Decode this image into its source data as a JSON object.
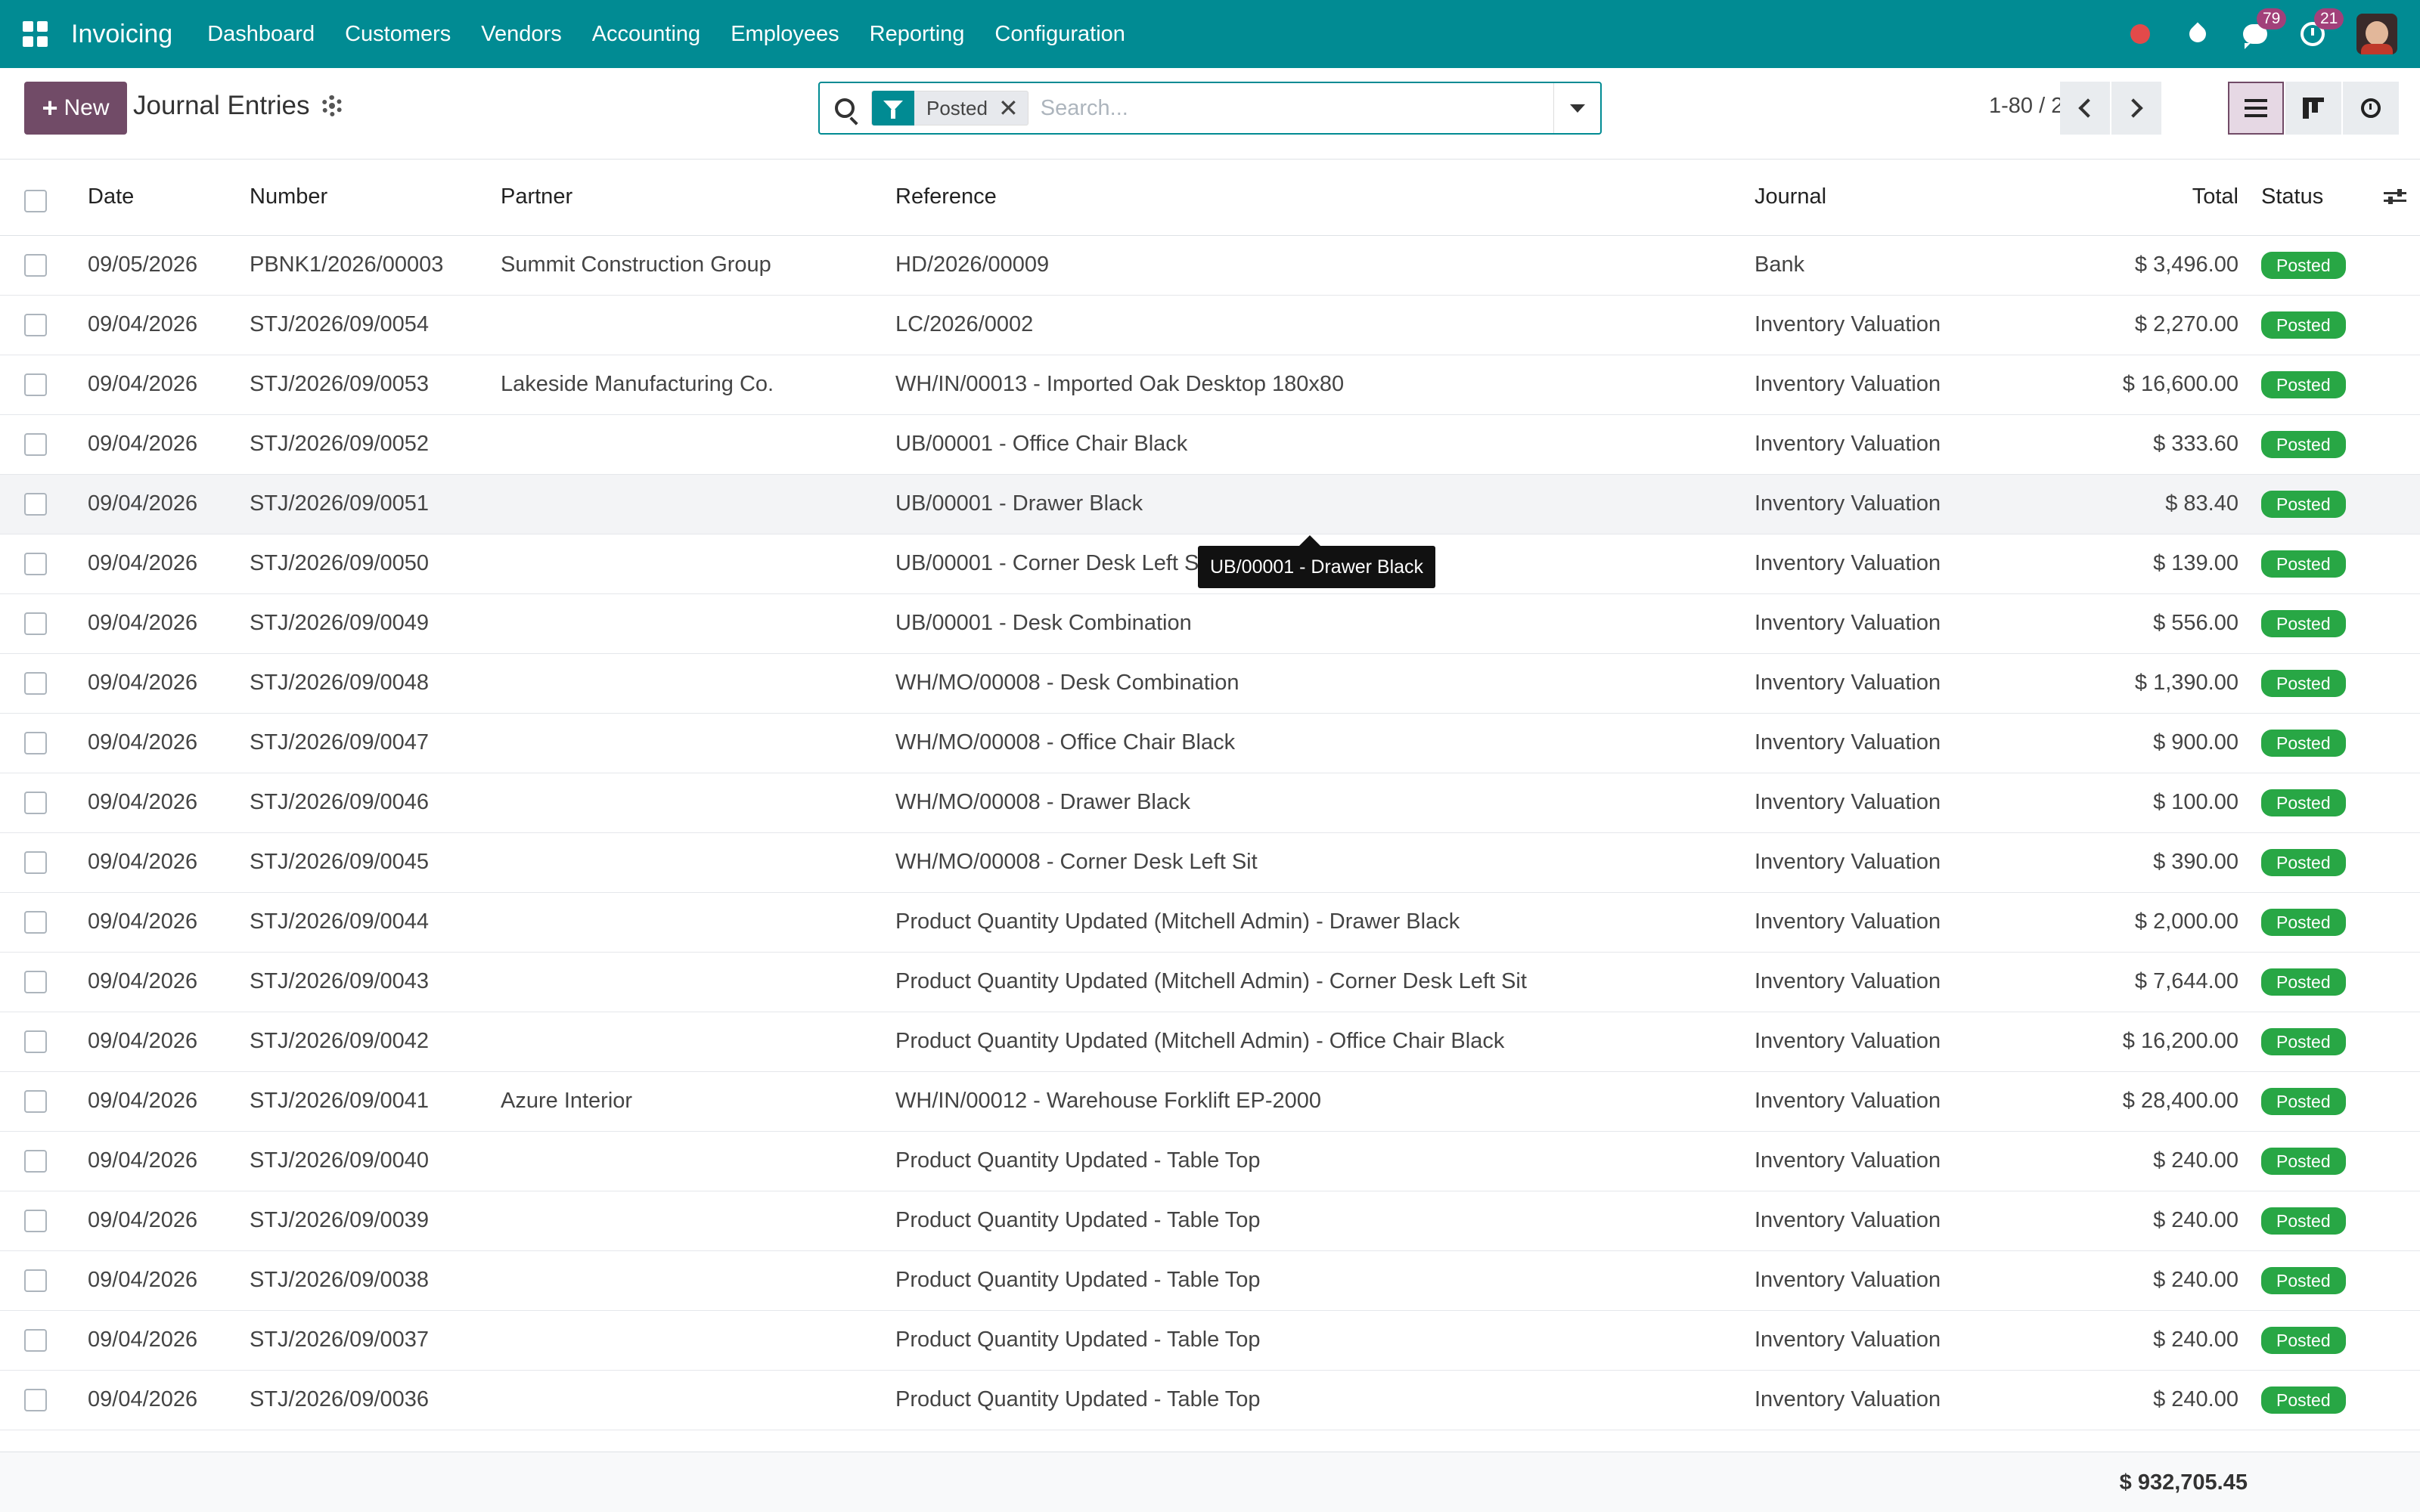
{
  "navbar": {
    "app_name": "Invoicing",
    "menu": [
      "Dashboard",
      "Customers",
      "Vendors",
      "Accounting",
      "Employees",
      "Reporting",
      "Configuration"
    ],
    "messages_count": "79",
    "activities_count": "21",
    "icons": [
      "apps-icon",
      "recording-dot-icon",
      "drop-icon",
      "chat-icon",
      "clock-icon",
      "avatar"
    ],
    "colors": {
      "navbar": "#018b93",
      "primary": "#714b67",
      "posted": "#28a745",
      "badge": "#a2407a"
    }
  },
  "control": {
    "new_label": "New",
    "title": "Journal Entries",
    "facet_label": "Posted",
    "facet_close": "✕",
    "search_placeholder": "Search...",
    "pager": "1-80 / 207"
  },
  "table": {
    "columns": {
      "date": "Date",
      "number": "Number",
      "partner": "Partner",
      "reference": "Reference",
      "journal": "Journal",
      "total": "Total",
      "status": "Status"
    },
    "rows": [
      {
        "date": "09/05/2026",
        "number": "PBNK1/2026/00003",
        "partner": "Summit Construction Group",
        "reference": "HD/2026/00009",
        "journal": "Bank",
        "total": "$ 3,496.00",
        "status": "Posted"
      },
      {
        "date": "09/04/2026",
        "number": "STJ/2026/09/0054",
        "partner": "",
        "reference": "LC/2026/0002",
        "journal": "Inventory Valuation",
        "total": "$ 2,270.00",
        "status": "Posted"
      },
      {
        "date": "09/04/2026",
        "number": "STJ/2026/09/0053",
        "partner": "Lakeside Manufacturing Co.",
        "reference": "WH/IN/00013 - Imported Oak Desktop 180x80",
        "journal": "Inventory Valuation",
        "total": "$ 16,600.00",
        "status": "Posted"
      },
      {
        "date": "09/04/2026",
        "number": "STJ/2026/09/0052",
        "partner": "",
        "reference": "UB/00001 - Office Chair Black",
        "journal": "Inventory Valuation",
        "total": "$ 333.60",
        "status": "Posted"
      },
      {
        "date": "09/04/2026",
        "number": "STJ/2026/09/0051",
        "partner": "",
        "reference": "UB/00001 - Drawer Black",
        "journal": "Inventory Valuation",
        "total": "$ 83.40",
        "status": "Posted"
      },
      {
        "date": "09/04/2026",
        "number": "STJ/2026/09/0050",
        "partner": "",
        "reference": "UB/00001 - Corner Desk Left Sit",
        "journal": "Inventory Valuation",
        "total": "$ 139.00",
        "status": "Posted"
      },
      {
        "date": "09/04/2026",
        "number": "STJ/2026/09/0049",
        "partner": "",
        "reference": "UB/00001 - Desk Combination",
        "journal": "Inventory Valuation",
        "total": "$ 556.00",
        "status": "Posted"
      },
      {
        "date": "09/04/2026",
        "number": "STJ/2026/09/0048",
        "partner": "",
        "reference": "WH/MO/00008 - Desk Combination",
        "journal": "Inventory Valuation",
        "total": "$ 1,390.00",
        "status": "Posted"
      },
      {
        "date": "09/04/2026",
        "number": "STJ/2026/09/0047",
        "partner": "",
        "reference": "WH/MO/00008 - Office Chair Black",
        "journal": "Inventory Valuation",
        "total": "$ 900.00",
        "status": "Posted"
      },
      {
        "date": "09/04/2026",
        "number": "STJ/2026/09/0046",
        "partner": "",
        "reference": "WH/MO/00008 - Drawer Black",
        "journal": "Inventory Valuation",
        "total": "$ 100.00",
        "status": "Posted"
      },
      {
        "date": "09/04/2026",
        "number": "STJ/2026/09/0045",
        "partner": "",
        "reference": "WH/MO/00008 - Corner Desk Left Sit",
        "journal": "Inventory Valuation",
        "total": "$ 390.00",
        "status": "Posted"
      },
      {
        "date": "09/04/2026",
        "number": "STJ/2026/09/0044",
        "partner": "",
        "reference": "Product Quantity Updated (Mitchell Admin) - Drawer Black",
        "journal": "Inventory Valuation",
        "total": "$ 2,000.00",
        "status": "Posted"
      },
      {
        "date": "09/04/2026",
        "number": "STJ/2026/09/0043",
        "partner": "",
        "reference": "Product Quantity Updated (Mitchell Admin) - Corner Desk Left Sit",
        "journal": "Inventory Valuation",
        "total": "$ 7,644.00",
        "status": "Posted"
      },
      {
        "date": "09/04/2026",
        "number": "STJ/2026/09/0042",
        "partner": "",
        "reference": "Product Quantity Updated (Mitchell Admin) - Office Chair Black",
        "journal": "Inventory Valuation",
        "total": "$ 16,200.00",
        "status": "Posted"
      },
      {
        "date": "09/04/2026",
        "number": "STJ/2026/09/0041",
        "partner": "Azure Interior",
        "reference": "WH/IN/00012 - Warehouse Forklift EP-2000",
        "journal": "Inventory Valuation",
        "total": "$ 28,400.00",
        "status": "Posted"
      },
      {
        "date": "09/04/2026",
        "number": "STJ/2026/09/0040",
        "partner": "",
        "reference": "Product Quantity Updated - Table Top",
        "journal": "Inventory Valuation",
        "total": "$ 240.00",
        "status": "Posted"
      },
      {
        "date": "09/04/2026",
        "number": "STJ/2026/09/0039",
        "partner": "",
        "reference": "Product Quantity Updated - Table Top",
        "journal": "Inventory Valuation",
        "total": "$ 240.00",
        "status": "Posted"
      },
      {
        "date": "09/04/2026",
        "number": "STJ/2026/09/0038",
        "partner": "",
        "reference": "Product Quantity Updated - Table Top",
        "journal": "Inventory Valuation",
        "total": "$ 240.00",
        "status": "Posted"
      },
      {
        "date": "09/04/2026",
        "number": "STJ/2026/09/0037",
        "partner": "",
        "reference": "Product Quantity Updated - Table Top",
        "journal": "Inventory Valuation",
        "total": "$ 240.00",
        "status": "Posted"
      },
      {
        "date": "09/04/2026",
        "number": "STJ/2026/09/0036",
        "partner": "",
        "reference": "Product Quantity Updated - Table Top",
        "journal": "Inventory Valuation",
        "total": "$ 240.00",
        "status": "Posted"
      }
    ]
  },
  "tooltip": {
    "text": "UB/00001 - Drawer Black"
  },
  "footer": {
    "total": "$ 932,705.45"
  }
}
